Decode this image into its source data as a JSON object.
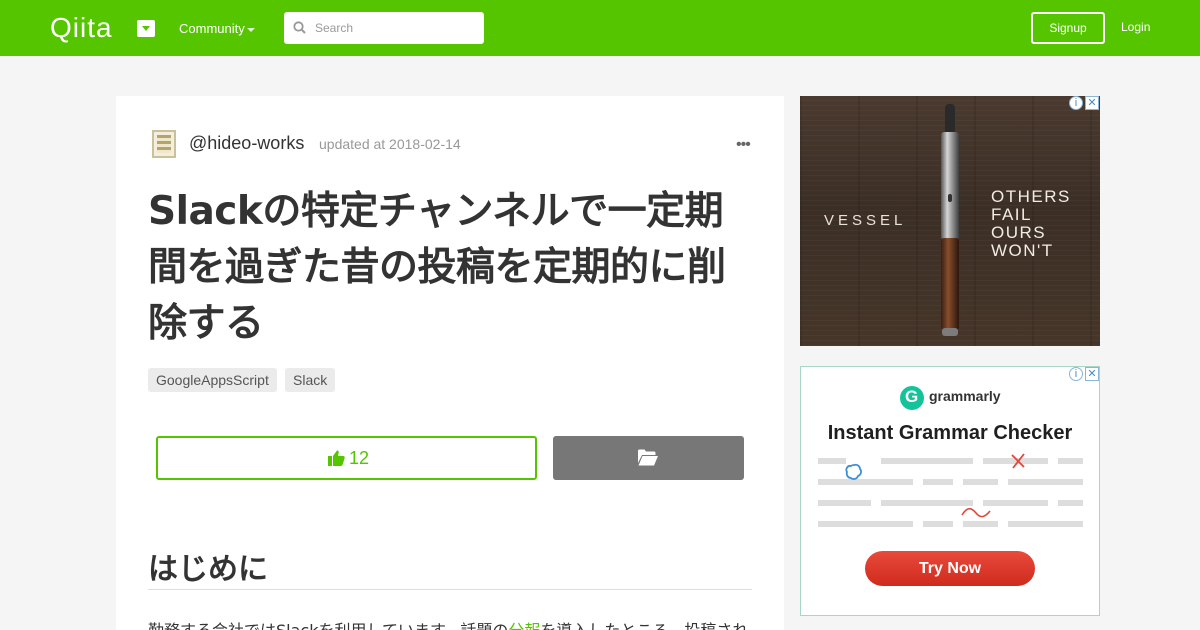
{
  "header": {
    "logo": "Qiita",
    "community_label": "Community",
    "search_placeholder": "Search",
    "signup_label": "Signup",
    "login_label": "Login",
    "brand_color": "#55c500"
  },
  "article": {
    "author": "@hideo-works",
    "updated": "updated at 2018-02-14",
    "title": "Slackの特定チャンネルで一定期間を過ぎた昔の投稿を定期的に削除する",
    "tags": [
      "GoogleAppsScript",
      "Slack"
    ],
    "like_count": "12",
    "heading": "はじめに",
    "body_before_link": "勤務する会社ではSlackを利用しています。話題の",
    "body_link": "分報",
    "body_after_link": "を導入したところ、投稿され"
  },
  "ads": {
    "vessel": {
      "brand": "VESSEL",
      "tagline_1": "OTHERS",
      "tagline_2": "FAIL",
      "tagline_3": "OURS",
      "tagline_4": "WON'T",
      "info_icon": "i",
      "close_icon": "✕"
    },
    "grammarly": {
      "brand": "grammarly",
      "logo_letter": "G",
      "headline": "Instant Grammar Checker",
      "cta": "Try Now",
      "info_icon": "i",
      "close_icon": "✕"
    }
  }
}
